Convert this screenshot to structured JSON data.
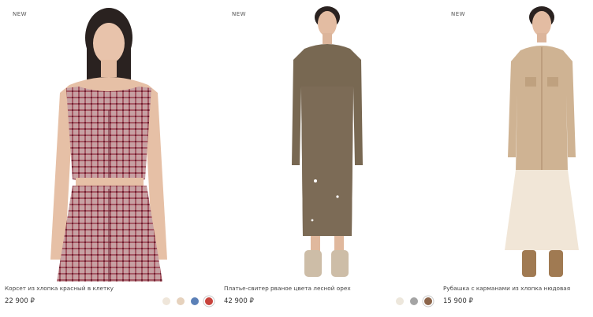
{
  "products": [
    {
      "badge": "NEW",
      "title": "Корсет из хлопка красный в клетку",
      "price": "22 900 ₽",
      "swatches": [
        "#efe6da",
        "#e6d2bd",
        "#5b80b7",
        "#c8433c"
      ]
    },
    {
      "badge": "NEW",
      "title": "Платье-свитер рваное цвета лесной орех",
      "price": "42 900 ₽",
      "swatches": [
        "#ede7dc",
        "#a4a4a4",
        "#8c654b"
      ]
    },
    {
      "badge": "NEW",
      "title": "Рубашка с карманами из хлопка нюдовая",
      "price": "15 900 ₽",
      "swatches": []
    }
  ]
}
